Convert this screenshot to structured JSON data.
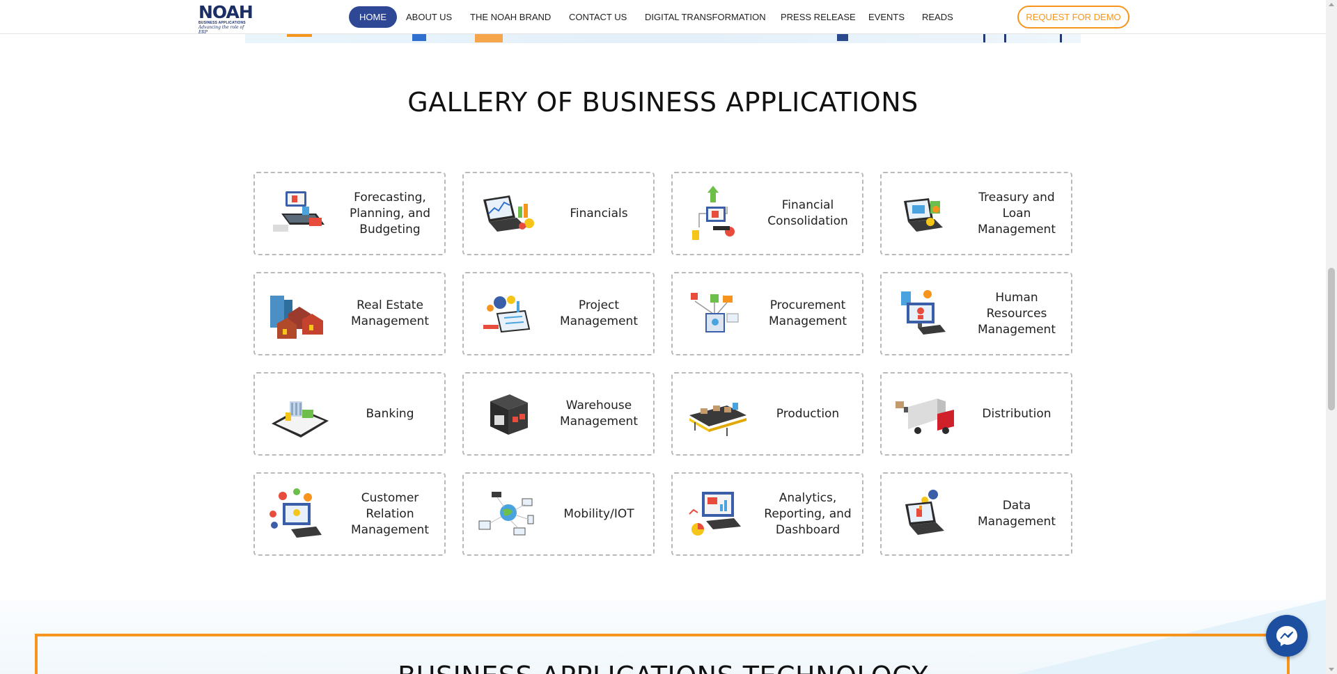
{
  "brand": {
    "logo_word": "NOAH",
    "logo_sub": "BUSINESS APPLICATIONS",
    "logo_tagline": "Advancing the role of ERP"
  },
  "nav": {
    "items": [
      {
        "label": "HOME",
        "active": true
      },
      {
        "label": "ABOUT US"
      },
      {
        "label": "THE NOAH BRAND"
      },
      {
        "label": "CONTACT US"
      },
      {
        "label": "DIGITAL TRANSFORMATION"
      },
      {
        "label": "PRESS RELEASE"
      },
      {
        "label": "EVENTS"
      },
      {
        "label": "READS"
      }
    ],
    "demo_button": "REQUEST FOR DEMO"
  },
  "gallery": {
    "title": "GALLERY OF BUSINESS APPLICATIONS",
    "cards": [
      {
        "label": "Forecasting, Planning, and Budgeting",
        "icon": "forecasting-laptop-icon"
      },
      {
        "label": "Financials",
        "icon": "financials-laptop-chart-icon"
      },
      {
        "label": "Financial Consolidation",
        "icon": "consolidation-flow-icon"
      },
      {
        "label": "Treasury and Loan Management",
        "icon": "treasury-laptop-icon"
      },
      {
        "label": "Real Estate Management",
        "icon": "real-estate-buildings-icon"
      },
      {
        "label": "Project Management",
        "icon": "project-gears-clipboard-icon"
      },
      {
        "label": "Procurement Management",
        "icon": "procurement-network-icon"
      },
      {
        "label": "Human Resources Management",
        "icon": "hr-monitor-people-icon"
      },
      {
        "label": "Banking",
        "icon": "banking-tablet-icon"
      },
      {
        "label": "Warehouse Management",
        "icon": "warehouse-building-icon"
      },
      {
        "label": "Production",
        "icon": "production-conveyor-icon"
      },
      {
        "label": "Distribution",
        "icon": "distribution-truck-icon"
      },
      {
        "label": "Customer Relation Management",
        "icon": "crm-monitor-icon"
      },
      {
        "label": "Mobility/IOT",
        "icon": "iot-globe-devices-icon"
      },
      {
        "label": "Analytics, Reporting, and Dashboard",
        "icon": "analytics-monitor-icon"
      },
      {
        "label": "Data Management",
        "icon": "data-laptop-gear-icon"
      }
    ]
  },
  "next_section": {
    "title": "BUSINESS APPLICATIONS TECHNOLOGY"
  },
  "colors": {
    "nav_active": "#2e4895",
    "accent_orange": "#f7941d",
    "brand_navy": "#1b2f66",
    "messenger_blue": "#1d4fa0"
  }
}
